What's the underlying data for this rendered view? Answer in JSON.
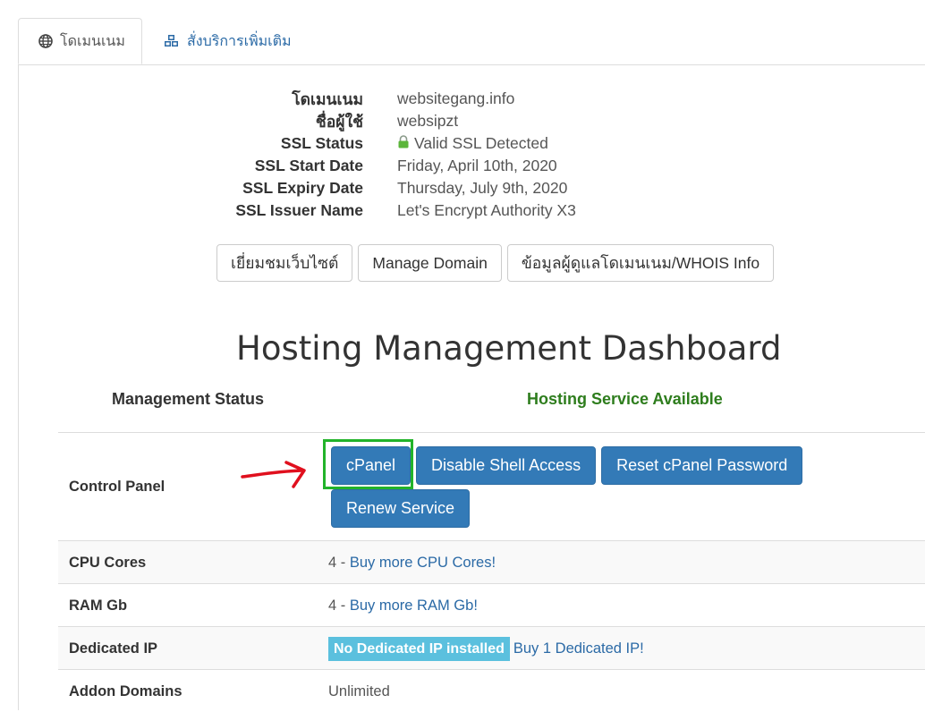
{
  "tabs": [
    {
      "label": "โดเมนเนม",
      "icon": "globe-icon"
    },
    {
      "label": "สั่งบริการเพิ่มเติม",
      "icon": "cubes-icon"
    }
  ],
  "domain_info": [
    {
      "label": "โดเมนเนม",
      "value": "websitegang.info"
    },
    {
      "label": "ชื่อผู้ใช้",
      "value": "websipzt"
    },
    {
      "label": "SSL Status",
      "value": "Valid SSL Detected",
      "icon": "lock-icon"
    },
    {
      "label": "SSL Start Date",
      "value": "Friday, April 10th, 2020"
    },
    {
      "label": "SSL Expiry Date",
      "value": "Thursday, July 9th, 2020"
    },
    {
      "label": "SSL Issuer Name",
      "value": "Let's Encrypt Authority X3"
    }
  ],
  "domain_buttons": {
    "visit": "เยี่ยมชมเว็บไซต์",
    "manage": "Manage Domain",
    "whois": "ข้อมูลผู้ดูแลโดเมนเนม/WHOIS Info"
  },
  "dashboard": {
    "title": "Hosting Management Dashboard",
    "status_label": "Management Status",
    "status_value": "Hosting Service Available"
  },
  "control_panel": {
    "label": "Control Panel",
    "buttons": {
      "cpanel": "cPanel",
      "disable_shell": "Disable Shell Access",
      "reset_password": "Reset cPanel Password",
      "renew": "Renew Service"
    }
  },
  "rows": {
    "cpu": {
      "label": "CPU Cores",
      "value": "4 -",
      "link": "Buy more CPU Cores!"
    },
    "ram": {
      "label": "RAM Gb",
      "value": "4 -",
      "link": "Buy more RAM Gb!"
    },
    "ip": {
      "label": "Dedicated IP",
      "badge": "No Dedicated IP installed",
      "link": "Buy 1 Dedicated IP!"
    },
    "addon": {
      "label": "Addon Domains",
      "value": "Unlimited"
    }
  },
  "colors": {
    "primary": "#337ab7",
    "link": "#2b6aa6",
    "success_text": "#2e7d1d",
    "info_badge": "#5bc0de",
    "highlight": "#22b32a",
    "annotation_arrow": "#e0101e"
  }
}
